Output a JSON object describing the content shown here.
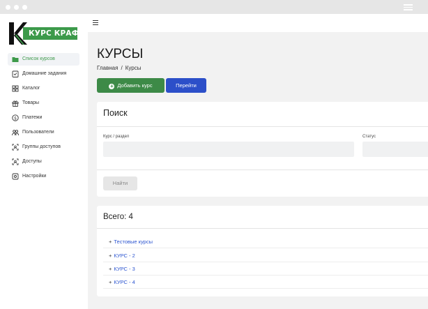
{
  "brand": {
    "logo_text": "КУРС КРАФТ"
  },
  "sidebar": {
    "items": [
      {
        "label": "Список курсов",
        "icon": "folder-icon",
        "active": true
      },
      {
        "label": "Домашние задания",
        "icon": "homework-icon"
      },
      {
        "label": "Каталог",
        "icon": "grid-icon"
      },
      {
        "label": "Товары",
        "icon": "gift-icon"
      },
      {
        "label": "Платежи",
        "icon": "dollar-icon"
      },
      {
        "label": "Пользователи",
        "icon": "users-icon"
      },
      {
        "label": "Группы доступов",
        "icon": "access-group-icon"
      },
      {
        "label": "Доступы",
        "icon": "access-icon"
      },
      {
        "label": "Настройки",
        "icon": "gear-icon"
      }
    ]
  },
  "page": {
    "title": "КУРСЫ",
    "breadcrumb": {
      "home": "Главная",
      "separator": "/",
      "current": "Курсы"
    }
  },
  "actions": {
    "add_course": "Добавить курс",
    "go": "Перейти"
  },
  "search": {
    "title": "Поиск",
    "course_label": "Курс / раздел",
    "course_value": "",
    "status_label": "Статус",
    "status_value": "",
    "submit": "Найти"
  },
  "list": {
    "total": "Всего: 4",
    "expand_symbol": "+",
    "items": [
      "Тестовые курсы",
      "КУРС - 2",
      "КУРС - 3",
      "КУРС - 4"
    ]
  },
  "colors": {
    "accent_green": "#3d8a47",
    "accent_blue": "#2c4fc9",
    "link_blue": "#2c55d0",
    "active_nav_text": "#3d9a4a"
  }
}
